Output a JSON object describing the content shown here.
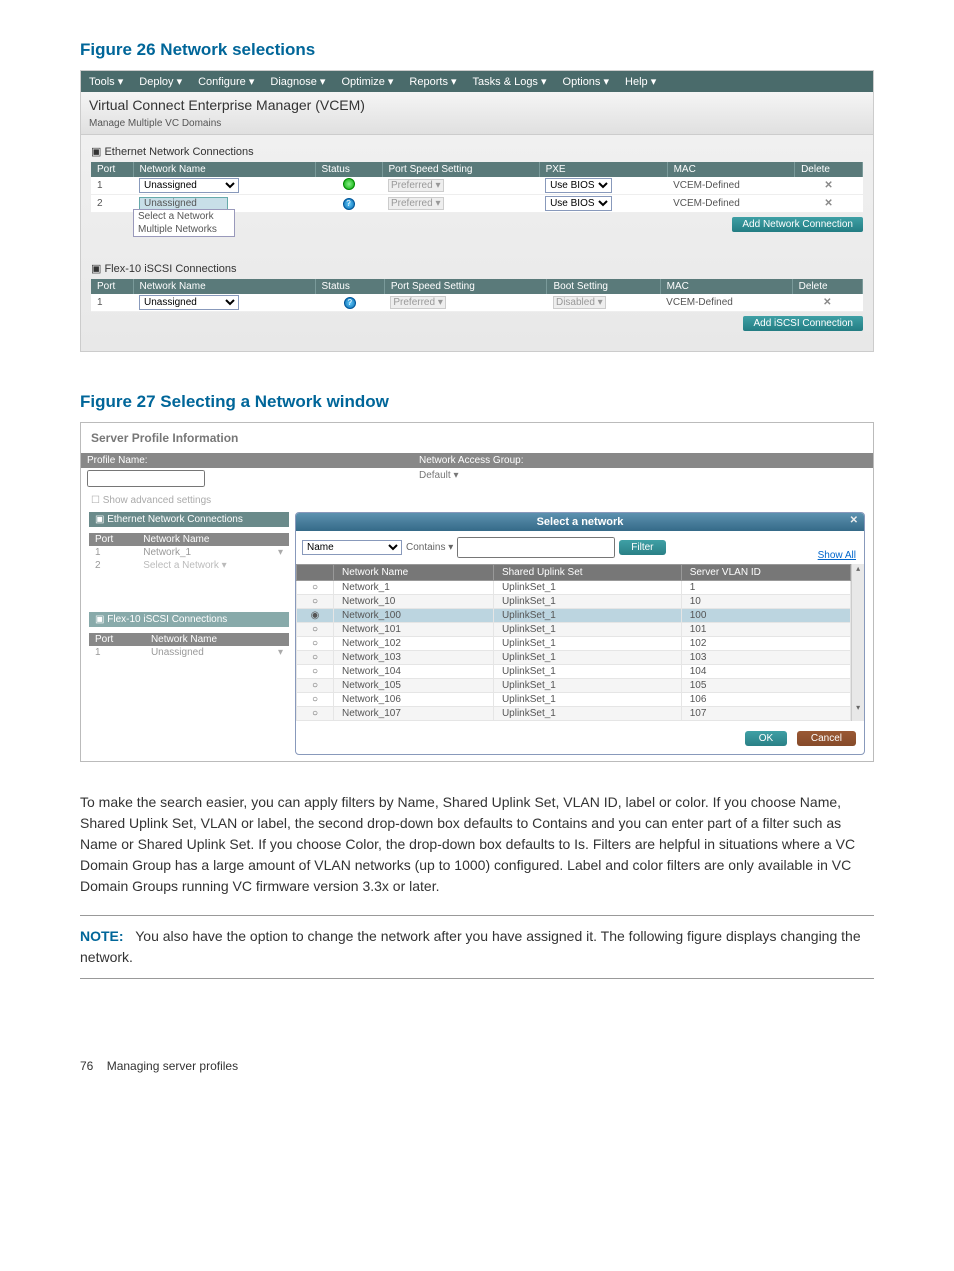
{
  "fig26": {
    "title": "Figure 26 Network selections",
    "menu": [
      "Tools ▾",
      "Deploy ▾",
      "Configure ▾",
      "Diagnose ▾",
      "Optimize ▾",
      "Reports ▾",
      "Tasks & Logs ▾",
      "Options ▾",
      "Help ▾"
    ],
    "app_title": "Virtual Connect Enterprise Manager (VCEM)",
    "app_subtitle": "Manage Multiple VC Domains",
    "eth_section": "Ethernet Network Connections",
    "eth_headers": [
      "Port",
      "Network Name",
      "Status",
      "Port Speed Setting",
      "PXE",
      "MAC",
      "Delete"
    ],
    "eth_rows": [
      {
        "port": "1",
        "net": "Unassigned",
        "speed": "Preferred",
        "pxe": "Use BIOS",
        "mac": "VCEM-Defined",
        "del": "✕"
      },
      {
        "port": "2",
        "net": "Unassigned",
        "speed": "Preferred",
        "pxe": "Use BIOS",
        "mac": "VCEM-Defined",
        "del": "✕"
      }
    ],
    "eth_dropdown": [
      "Select a Network",
      "Multiple Networks"
    ],
    "btn_add_eth": "Add Network Connection",
    "iscsi_section": "Flex-10 iSCSI Connections",
    "iscsi_headers": [
      "Port",
      "Network Name",
      "Status",
      "Port Speed Setting",
      "Boot Setting",
      "MAC",
      "Delete"
    ],
    "iscsi_row": {
      "port": "1",
      "net": "Unassigned",
      "speed": "Preferred",
      "boot": "Disabled",
      "mac": "VCEM-Defined",
      "del": "✕"
    },
    "btn_add_iscsi": "Add iSCSI Connection"
  },
  "fig27": {
    "title": "Figure 27 Selecting a Network window",
    "spi_title": "Server Profile Information",
    "bar1": "Profile Name:",
    "bar2": "Network Access Group:",
    "default_val": "Default  ▾",
    "adv": "Show advanced settings",
    "eth_section": "Ethernet Network Connections",
    "left_headers": [
      "Port",
      "Network Name"
    ],
    "left_rows": [
      {
        "port": "1",
        "net": "Network_1"
      },
      {
        "port": "2",
        "net": "Select a Network  ▾"
      }
    ],
    "iscsi_section": "Flex-10 iSCSI Connections",
    "iscsi_row": {
      "port": "1",
      "net": "Unassigned"
    },
    "modal_title": "Select a network",
    "filter_name": "Name",
    "filter_op": "Contains  ▾",
    "filter_btn": "Filter",
    "show_all": "Show All",
    "net_headers": [
      "",
      "Network Name",
      "Shared Uplink Set",
      "Server VLAN ID"
    ],
    "net_rows": [
      {
        "n": "Network_1",
        "u": "UplinkSet_1",
        "v": "1",
        "sel": false
      },
      {
        "n": "Network_10",
        "u": "UplinkSet_1",
        "v": "10",
        "sel": false
      },
      {
        "n": "Network_100",
        "u": "UplinkSet_1",
        "v": "100",
        "sel": true
      },
      {
        "n": "Network_101",
        "u": "UplinkSet_1",
        "v": "101",
        "sel": false
      },
      {
        "n": "Network_102",
        "u": "UplinkSet_1",
        "v": "102",
        "sel": false
      },
      {
        "n": "Network_103",
        "u": "UplinkSet_1",
        "v": "103",
        "sel": false
      },
      {
        "n": "Network_104",
        "u": "UplinkSet_1",
        "v": "104",
        "sel": false
      },
      {
        "n": "Network_105",
        "u": "UplinkSet_1",
        "v": "105",
        "sel": false
      },
      {
        "n": "Network_106",
        "u": "UplinkSet_1",
        "v": "106",
        "sel": false
      },
      {
        "n": "Network_107",
        "u": "UplinkSet_1",
        "v": "107",
        "sel": false
      }
    ],
    "ok": "OK",
    "cancel": "Cancel"
  },
  "body_text": "To make the search easier, you can apply filters by Name, Shared Uplink Set, VLAN ID, label or color. If you choose Name, Shared Uplink Set, VLAN or label, the second drop-down box defaults to Contains and you can enter part of a filter such as Name or Shared Uplink Set. If you choose Color, the drop-down box defaults to Is. Filters are helpful in situations where a VC Domain Group has a large amount of VLAN networks (up to 1000) configured. Label and color filters are only available in VC Domain Groups running VC firmware version 3.3x or later.",
  "note_label": "NOTE:",
  "note_text": "You also have the option to change the network after you have assigned it. The following figure displays changing the network.",
  "page_num": "76",
  "page_section": "Managing server profiles"
}
